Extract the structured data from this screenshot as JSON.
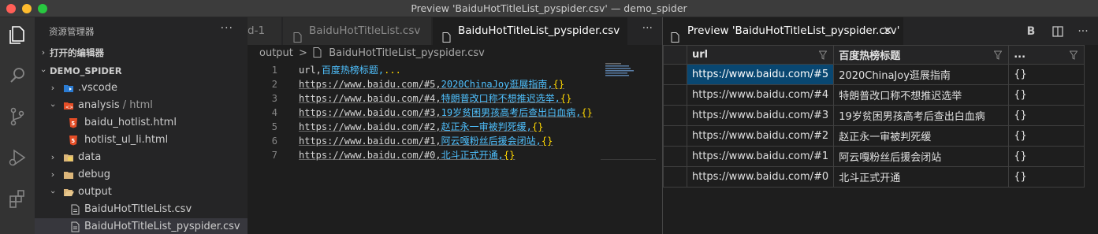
{
  "window": {
    "title": "Preview 'BaiduHotTitleList_pyspider.csv' — demo_spider"
  },
  "activity_bar": {
    "icons": [
      "explorer-icon",
      "search-icon",
      "source-control-icon",
      "run-debug-icon",
      "extensions-icon"
    ]
  },
  "sidebar": {
    "header": "资源管理器",
    "more": "···",
    "open_editors": "打开的编辑器",
    "project": "DEMO_SPIDER",
    "tree": [
      {
        "label": ".vscode"
      },
      {
        "label": "analysis",
        "path_suffix": " / html"
      },
      {
        "label": "baidu_hotlist.html"
      },
      {
        "label": "hotlist_ul_li.html"
      },
      {
        "label": "data"
      },
      {
        "label": "debug"
      },
      {
        "label": "output"
      },
      {
        "label": "BaiduHotTitleList.csv"
      },
      {
        "label": "BaiduHotTitleList_pyspider.csv"
      }
    ]
  },
  "editor": {
    "tabs": [
      {
        "label": "d-1"
      },
      {
        "label": "BaiduHotTitleList.csv"
      },
      {
        "label": "BaiduHotTitleList_pyspider.csv"
      }
    ],
    "more": "···",
    "breadcrumb": {
      "folder": "output",
      "separator": ">",
      "file": "BaiduHotTitleList_pyspider.csv"
    },
    "lines": [
      {
        "num": "1",
        "url": "url,",
        "title": "百度热榜标题,",
        "obj": "...",
        "tail": ""
      },
      {
        "num": "2",
        "url": "https://www.baidu.com/#5,",
        "title": "2020ChinaJoy逛展指南,",
        "obj": "{}",
        "tail": ""
      },
      {
        "num": "3",
        "url": "https://www.baidu.com/#4,",
        "title": "特朗普改口称不想推迟选举,",
        "obj": "{}",
        "tail": ""
      },
      {
        "num": "4",
        "url": "https://www.baidu.com/#3,",
        "title": "19岁贫困男孩高考后查出白血病,",
        "obj": "{}",
        "tail": ""
      },
      {
        "num": "5",
        "url": "https://www.baidu.com/#2,",
        "title": "赵正永一审被判死缓,",
        "obj": "{}",
        "tail": ""
      },
      {
        "num": "6",
        "url": "https://www.baidu.com/#1,",
        "title": "阿云嘎粉丝后援会闭站,",
        "obj": "{}",
        "tail": ""
      },
      {
        "num": "7",
        "url": "https://www.baidu.com/#0,",
        "title": "北斗正式开通,",
        "obj": "{}",
        "tail": ""
      }
    ]
  },
  "preview": {
    "tab_label": "Preview 'BaiduHotTitleList_pyspider.csv'",
    "close": "✕",
    "actions": [
      "B",
      "columns-icon",
      "···"
    ],
    "columns": [
      "url",
      "百度热榜标题",
      "..."
    ],
    "rows": [
      [
        "https://www.baidu.com/#5",
        "2020ChinaJoy逛展指南",
        "{}"
      ],
      [
        "https://www.baidu.com/#4",
        "特朗普改口称不想推迟选举",
        "{}"
      ],
      [
        "https://www.baidu.com/#3",
        "19岁贫困男孩高考后查出白血病",
        "{}"
      ],
      [
        "https://www.baidu.com/#2",
        "赵正永一审被判死缓",
        "{}"
      ],
      [
        "https://www.baidu.com/#1",
        "阿云嘎粉丝后援会闭站",
        "{}"
      ],
      [
        "https://www.baidu.com/#0",
        "北斗正式开通",
        "{}"
      ]
    ]
  },
  "colors": {
    "accent": "#094771",
    "html_icon": "#e44d26",
    "folder": "#dcb67a"
  }
}
